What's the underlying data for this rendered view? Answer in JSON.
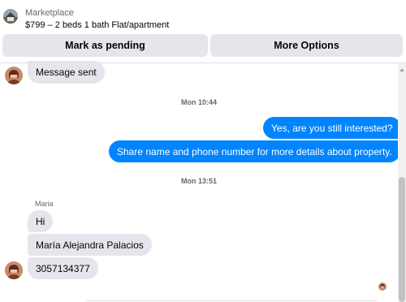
{
  "header": {
    "source_label": "Marketplace",
    "listing_title": "$799 – 2 beds 1 bath Flat/apartment",
    "pending_button": "Mark as pending",
    "more_button": "More Options",
    "thumbnail_icon": "house-thumbnail"
  },
  "thread": {
    "msg_sent": "Message sent",
    "time_1": "Mon 10:44",
    "out_1": "Yes, are you still interested?",
    "out_2": "Share name and phone number for more details about property.",
    "time_2": "Mon 13:51",
    "sender_name": "Maria",
    "in_1": "Hi",
    "in_2": "María Alejandra Palacios",
    "in_3": "3057134377"
  },
  "colors": {
    "outgoing": "#0084ff",
    "incoming": "#e4e6eb",
    "button": "#e4e6eb"
  }
}
